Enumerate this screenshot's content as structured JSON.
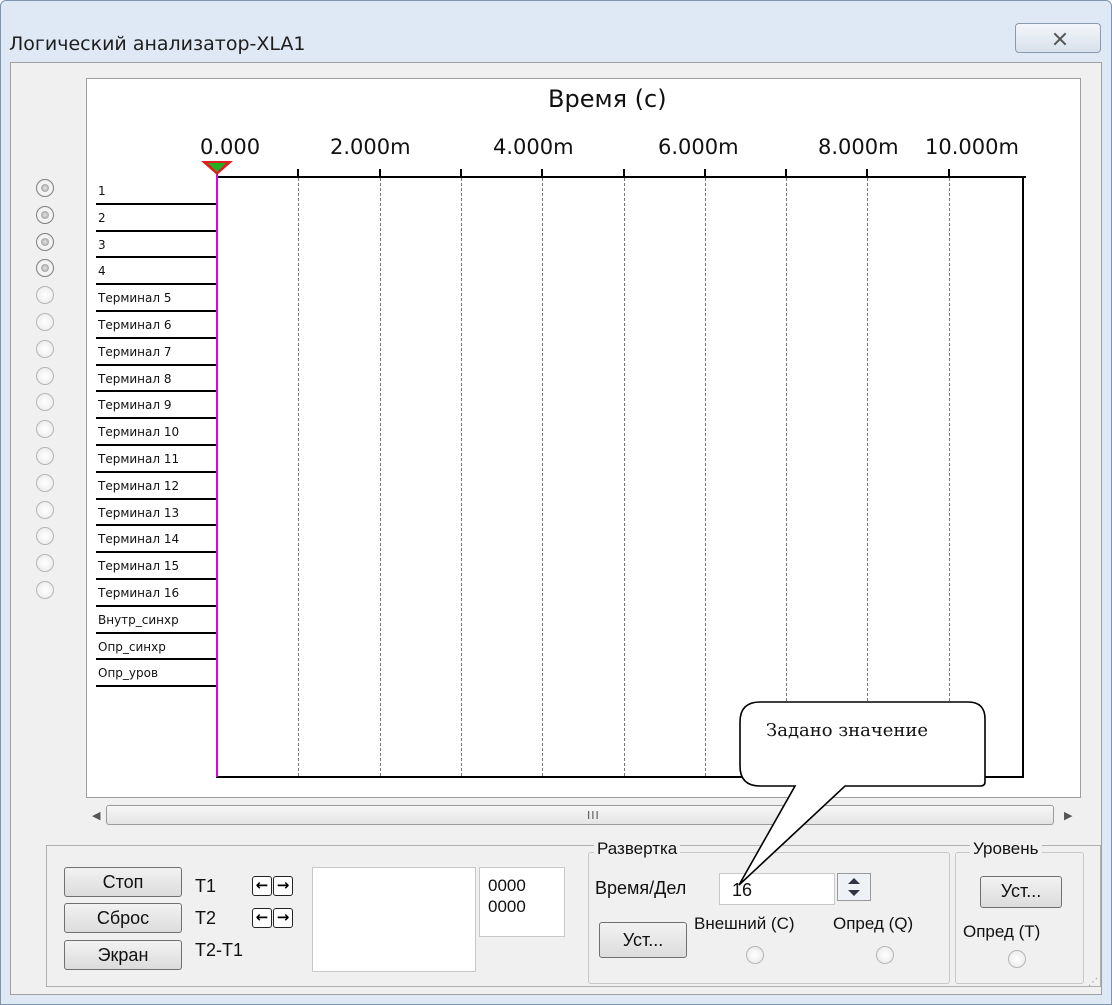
{
  "window": {
    "title": "Логический анализатор-XLA1"
  },
  "plot": {
    "axis_title": "Время (с)",
    "ticks": [
      "0.000",
      "2.000m",
      "4.000m",
      "6.000m",
      "8.000m",
      "10.000m"
    ],
    "channels": [
      {
        "label": "1",
        "enabled": true
      },
      {
        "label": "2",
        "enabled": true
      },
      {
        "label": "3",
        "enabled": true
      },
      {
        "label": "4",
        "enabled": true
      },
      {
        "label": "Терминал 5",
        "enabled": false
      },
      {
        "label": "Терминал 6",
        "enabled": false
      },
      {
        "label": "Терминал 7",
        "enabled": false
      },
      {
        "label": "Терминал 8",
        "enabled": false
      },
      {
        "label": "Терминал 9",
        "enabled": false
      },
      {
        "label": "Терминал 10",
        "enabled": false
      },
      {
        "label": "Терминал 11",
        "enabled": false
      },
      {
        "label": "Терминал 12",
        "enabled": false
      },
      {
        "label": "Терминал 13",
        "enabled": false
      },
      {
        "label": "Терминал 14",
        "enabled": false
      },
      {
        "label": "Терминал 15",
        "enabled": false
      },
      {
        "label": "Терминал 16",
        "enabled": false
      }
    ],
    "extra_rows": [
      "Внутр_синхр",
      "Опр_синхр",
      "Опр_уров"
    ]
  },
  "scrollbar": {
    "grip": "III"
  },
  "controls": {
    "stop": "Стоп",
    "reset": "Сброс",
    "screen": "Экран",
    "t1": "T1",
    "t2": "T2",
    "t2t1": "T2-T1",
    "t1_value": "0000",
    "t2_value": "0000"
  },
  "sweep": {
    "group_title": "Развертка",
    "time_div_label": "Время/Дел",
    "time_div_value": "16",
    "set_button": "Уст...",
    "external": "Внешний (С)",
    "define_q": "Опред (Q)"
  },
  "level": {
    "group_title": "Уровень",
    "set_button": "Уст...",
    "define_t": "Опред (Т)"
  },
  "callout": {
    "text": "Задано значение"
  }
}
